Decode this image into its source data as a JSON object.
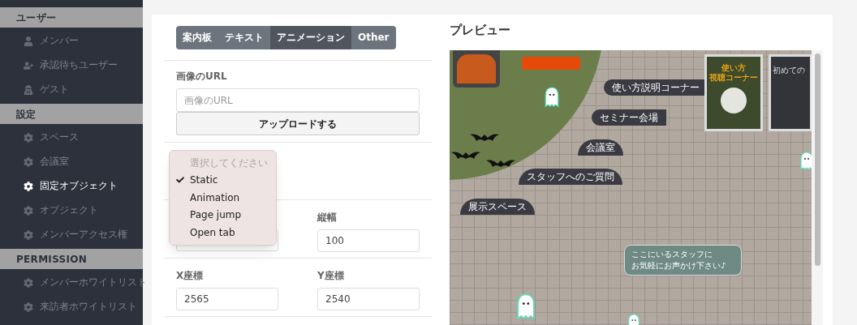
{
  "sidebar": {
    "sections": [
      {
        "title": "ユーザー",
        "items": [
          {
            "label": "メンバー",
            "selected": false
          },
          {
            "label": "承認待ちユーザー",
            "selected": false
          },
          {
            "label": "ゲスト",
            "selected": false
          }
        ]
      },
      {
        "title": "設定",
        "items": [
          {
            "label": "スペース",
            "selected": false
          },
          {
            "label": "会議室",
            "selected": false
          },
          {
            "label": "固定オブジェクト",
            "selected": true
          },
          {
            "label": "オブジェクト",
            "selected": false
          },
          {
            "label": "メンバーアクセス権",
            "selected": false
          }
        ]
      },
      {
        "title": "PERMISSION",
        "items": [
          {
            "label": "メンバーホワイトリスト",
            "selected": false
          },
          {
            "label": "来訪者ホワイトリスト",
            "selected": false
          }
        ]
      }
    ]
  },
  "form": {
    "tabs": [
      {
        "label": "案内板",
        "selected": false
      },
      {
        "label": "テキスト",
        "selected": false
      },
      {
        "label": "アニメーション",
        "selected": true
      },
      {
        "label": "Other",
        "selected": false
      }
    ],
    "image_url": {
      "label": "画像のURL",
      "placeholder": "画像のURL"
    },
    "upload_button": "アップロードする",
    "dropdown": {
      "options": [
        {
          "label": "選択してください",
          "kind": "placeholder",
          "selected": false
        },
        {
          "label": "Static",
          "kind": "option",
          "selected": true
        },
        {
          "label": "Animation",
          "kind": "option",
          "selected": false
        },
        {
          "label": "Page jump",
          "kind": "option",
          "selected": false
        },
        {
          "label": "Open tab",
          "kind": "option",
          "selected": false
        }
      ]
    },
    "height_field": {
      "label": "縦幅",
      "value": "100"
    },
    "x_field": {
      "label": "X座標",
      "value": "2565"
    },
    "y_field": {
      "label": "Y座標",
      "value": "2540"
    }
  },
  "preview": {
    "title": "プレビュー",
    "map_labels": [
      {
        "text": "使い方説明コーナー"
      },
      {
        "text": "セミナー会場"
      },
      {
        "text": "会議室"
      },
      {
        "text": "スタッフへのご質問"
      },
      {
        "text": "展示スペース"
      }
    ],
    "sign_title": [
      "使い方",
      "視聴コーナー"
    ],
    "second_sign": "初めての",
    "speech_bubble": [
      "ここにいるスタッフに",
      "お気軽にお声かけ下さい♪"
    ]
  }
}
